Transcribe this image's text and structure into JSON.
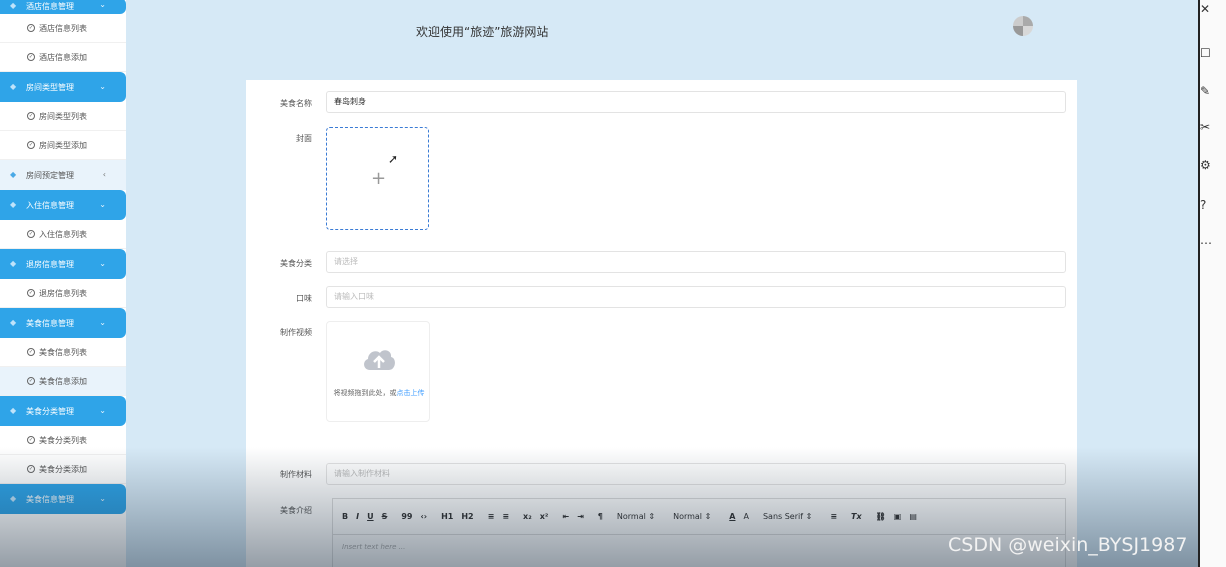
{
  "sidebar": {
    "top_group_label": "酒店信息管理",
    "items": [
      {
        "type": "item",
        "label": "酒店信息列表"
      },
      {
        "type": "item",
        "label": "酒店信息添加"
      },
      {
        "type": "group",
        "label": "房间类型管理"
      },
      {
        "type": "item",
        "label": "房间类型列表"
      },
      {
        "type": "item",
        "label": "房间类型添加"
      },
      {
        "type": "group-collapsed",
        "label": "房间预定管理"
      },
      {
        "type": "group",
        "label": "入住信息管理"
      },
      {
        "type": "item",
        "label": "入住信息列表"
      },
      {
        "type": "group",
        "label": "退房信息管理"
      },
      {
        "type": "item",
        "label": "退房信息列表"
      },
      {
        "type": "group",
        "label": "美食信息管理"
      },
      {
        "type": "item",
        "label": "美食信息列表"
      },
      {
        "type": "item-active",
        "label": "美食信息添加"
      },
      {
        "type": "group",
        "label": "美食分类管理"
      },
      {
        "type": "item",
        "label": "美食分类列表"
      },
      {
        "type": "item",
        "label": "美食分类添加"
      },
      {
        "type": "group",
        "label": "美食信息管理"
      }
    ]
  },
  "header": {
    "title": "欢迎使用“旅迹”旅游网站"
  },
  "form": {
    "name_label": "美食名称",
    "name_value": "春岛刺身",
    "cover_label": "封面",
    "category_label": "美食分类",
    "category_placeholder": "请选择",
    "taste_label": "口味",
    "taste_placeholder": "请输入口味",
    "video_label": "制作视频",
    "video_hint": "将视频拖到此处，或",
    "video_link": "点击上传",
    "material_label": "制作材料",
    "material_placeholder": "请输入制作材料",
    "intro_label": "美食介绍",
    "editor_placeholder": "Insert text here ..."
  },
  "toolbar": {
    "bold": "B",
    "italic": "I",
    "underline": "U",
    "strike": "S",
    "quote": "99",
    "code": "‹›",
    "h1": "H1",
    "h2": "H2",
    "ol": "≡",
    "ul": "≡",
    "sub": "x₂",
    "sup": "x²",
    "outdent": "⇤",
    "indent": "⇥",
    "rtl": "¶",
    "size": "Normal",
    "header": "Normal",
    "color": "A",
    "bg": "A",
    "font": "Sans Serif",
    "align": "≡",
    "clean": "Tx",
    "link": "🔗",
    "image": "▣",
    "video": "▤"
  },
  "watermark": "CSDN @weixin_BYSJ1987",
  "colors": {
    "accent": "#2fa4e8",
    "link": "#409eff",
    "page_bg": "#d6e9f6"
  }
}
